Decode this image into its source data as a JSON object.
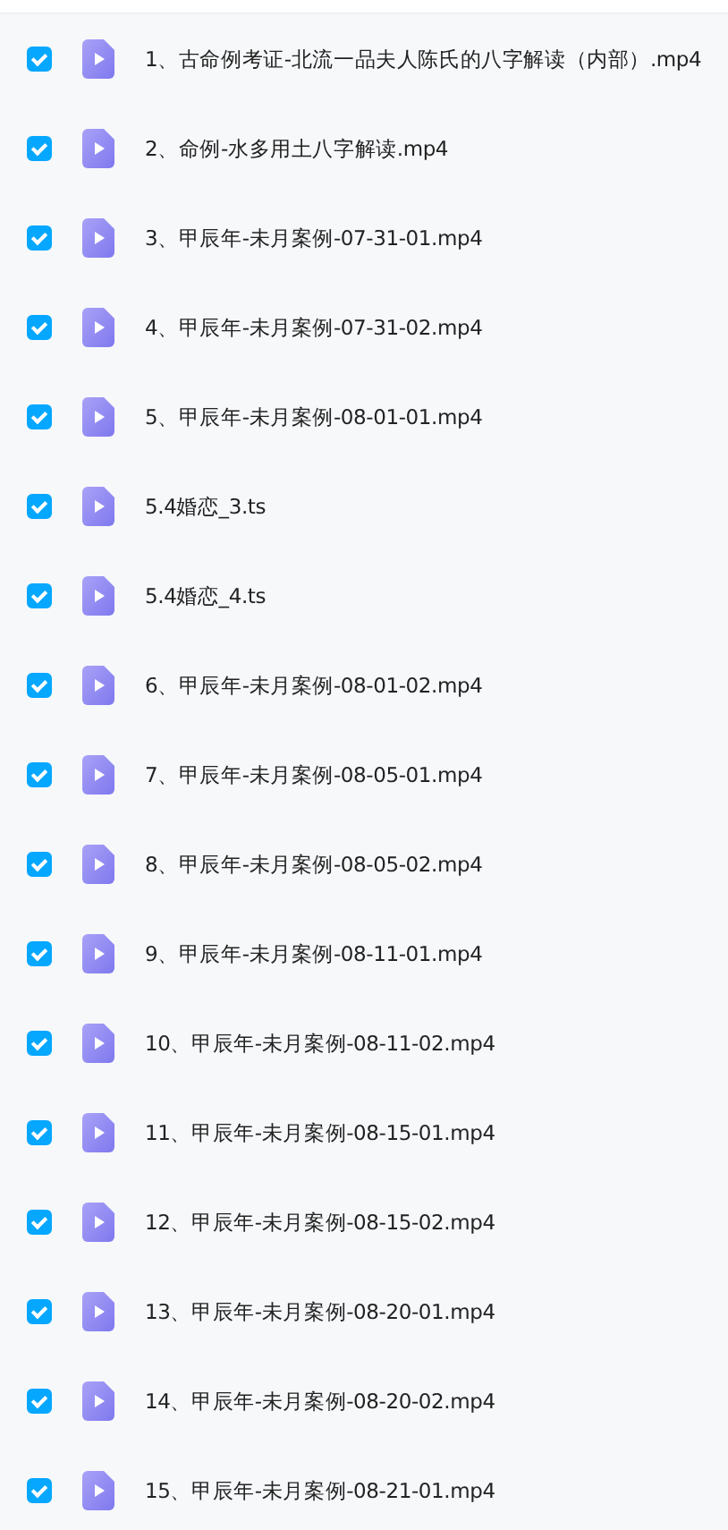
{
  "files": [
    {
      "name": "1、古命例考证-北流一品夫人陈氏的八字解读（内部）.mp4",
      "checked": true
    },
    {
      "name": "2、命例-水多用土八字解读.mp4",
      "checked": true
    },
    {
      "name": "3、甲辰年-未月案例-07-31-01.mp4",
      "checked": true
    },
    {
      "name": "4、甲辰年-未月案例-07-31-02.mp4",
      "checked": true
    },
    {
      "name": "5、甲辰年-未月案例-08-01-01.mp4",
      "checked": true
    },
    {
      "name": "5.4婚恋_3.ts",
      "checked": true
    },
    {
      "name": "5.4婚恋_4.ts",
      "checked": true
    },
    {
      "name": "6、甲辰年-未月案例-08-01-02.mp4",
      "checked": true
    },
    {
      "name": "7、甲辰年-未月案例-08-05-01.mp4",
      "checked": true
    },
    {
      "name": "8、甲辰年-未月案例-08-05-02.mp4",
      "checked": true
    },
    {
      "name": "9、甲辰年-未月案例-08-11-01.mp4",
      "checked": true
    },
    {
      "name": "10、甲辰年-未月案例-08-11-02.mp4",
      "checked": true
    },
    {
      "name": "11、甲辰年-未月案例-08-15-01.mp4",
      "checked": true
    },
    {
      "name": "12、甲辰年-未月案例-08-15-02.mp4",
      "checked": true
    },
    {
      "name": "13、甲辰年-未月案例-08-20-01.mp4",
      "checked": true
    },
    {
      "name": "14、甲辰年-未月案例-08-20-02.mp4",
      "checked": true
    },
    {
      "name": "15、甲辰年-未月案例-08-21-01.mp4",
      "checked": true
    }
  ]
}
